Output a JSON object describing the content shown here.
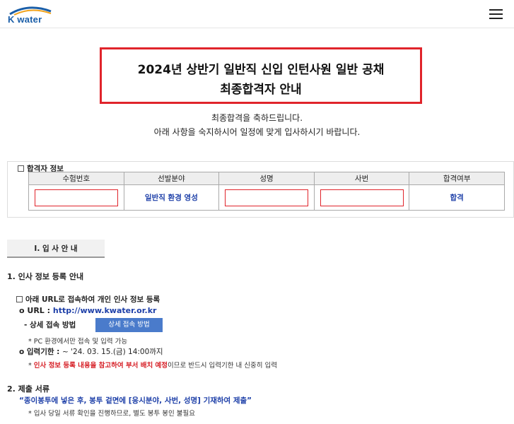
{
  "header": {
    "logo_text": "K water",
    "menu_icon": "hamburger-menu-icon"
  },
  "title": {
    "line1": "2024년 상반기 일반직 신입 인턴사원 일반 공채",
    "line2": "최종합격자 안내"
  },
  "congrats": {
    "line1": "최종합격을 축하드립니다.",
    "line2": "아래 사항을 숙지하시어 일정에 맞게 입사하시기 바랍니다."
  },
  "pass_info": {
    "title": "합격자 정보",
    "columns": [
      "수험번호",
      "선발분야",
      "성명",
      "사번",
      "합격여부"
    ],
    "row": {
      "exam_number": "",
      "field": "일반직 환경 영성",
      "name": "",
      "employee_id": "",
      "result": "합격"
    }
  },
  "section_tab": "Ⅰ. 입 사 안 내",
  "section1": {
    "heading": "1. 인사 정보 등록 안내",
    "sub": "아래 URL로 접속하여 개인 인사 정보 등록",
    "url_label": "o URL : ",
    "url": "http://www.kwater.or.kr",
    "detail_label": "- 상세 접속 방법",
    "detail_button": "상세 접속 방법",
    "pc_note": "* PC 환경에서만 접속 및 입력 가능",
    "deadline_label": "o 입력기한 : ",
    "deadline_value": "~ '24. 03. 15.(금) 14:00까지",
    "warn_prefix": "* ",
    "warn_red": "인사 정보 등록 내용을 참고하여 부서 배치 예정",
    "warn_rest": "이므로 반드시 입력기한 내 신중히 입력"
  },
  "section2": {
    "heading": "2. 제출 서류",
    "quote": "“종이봉투에 넣은 후, 봉투 겉면에 [응시분야, 사번, 성명] 기재하여 제출”",
    "note": "* 입사 당일 서류 확인을 진행하므로, 별도 봉투 봉인 불필요"
  },
  "colors": {
    "brand_blue": "#1a5ea8",
    "highlight_red": "#e0242b",
    "button_blue": "#4a7bcb"
  }
}
